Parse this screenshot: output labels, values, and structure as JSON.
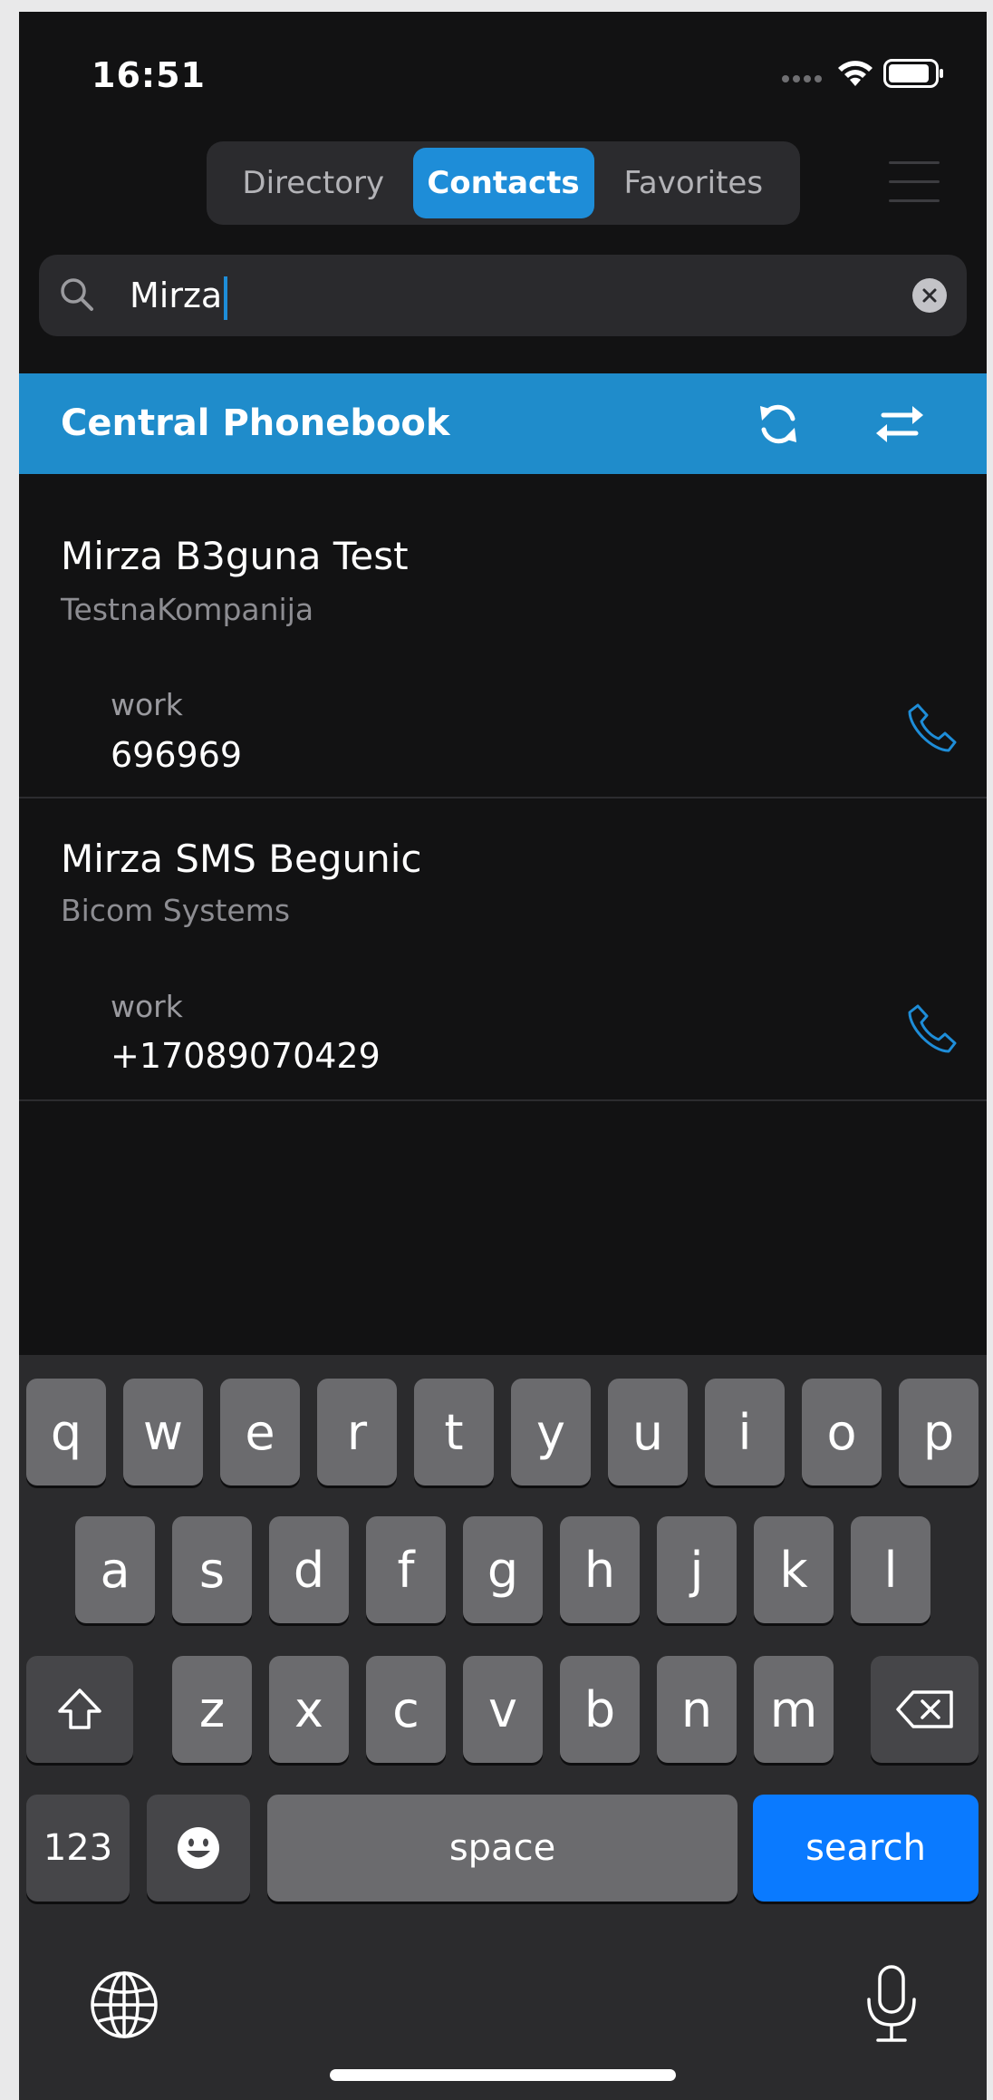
{
  "status": {
    "time": "16:51"
  },
  "tabs": [
    {
      "label": "Directory"
    },
    {
      "label": "Contacts"
    },
    {
      "label": "Favorites"
    }
  ],
  "search": {
    "value": "Mirza"
  },
  "phonebook": {
    "title": "Central Phonebook"
  },
  "contacts": [
    {
      "name": "Mirza B3guna Test",
      "company": "TestnaKompanija",
      "label": "work",
      "number": "696969"
    },
    {
      "name": "Mirza SMS Begunic",
      "company": "Bicom Systems",
      "label": "work",
      "number": "+17089070429"
    }
  ],
  "keyboard": {
    "row1": [
      "q",
      "w",
      "e",
      "r",
      "t",
      "y",
      "u",
      "i",
      "o",
      "p"
    ],
    "row2": [
      "a",
      "s",
      "d",
      "f",
      "g",
      "h",
      "j",
      "k",
      "l"
    ],
    "row3": [
      "z",
      "x",
      "c",
      "v",
      "b",
      "n",
      "m"
    ],
    "numbers_label": "123",
    "space_label": "space",
    "search_label": "search"
  },
  "colors": {
    "accent": "#1e8dd8",
    "header": "#1f8ccb",
    "search_key": "#0a7aff"
  }
}
